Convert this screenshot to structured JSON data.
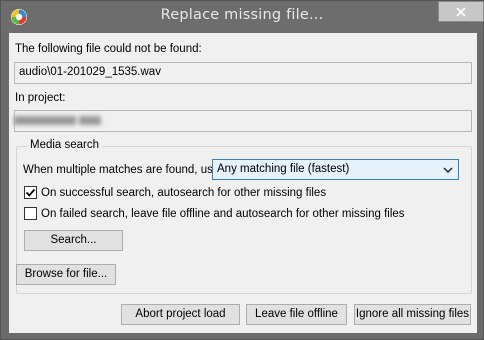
{
  "window": {
    "title": "Replace missing file..."
  },
  "dialog": {
    "missing_label": "The following file could not be found:",
    "missing_file": "audio\\01-201029_1535.wav",
    "project_label": "In project:",
    "project_value": ""
  },
  "media_search": {
    "group_title": "Media search",
    "multiple_label": "When multiple matches are found, use:",
    "match_mode": "Any matching file (fastest)",
    "autosearch_success": {
      "label": "On successful search, autosearch for other missing files",
      "checked": true
    },
    "autosearch_failed": {
      "label": "On failed search, leave file offline and autosearch for other missing files",
      "checked": false
    },
    "search_button": "Search..."
  },
  "buttons": {
    "browse": "Browse for file...",
    "abort": "Abort project load",
    "leave_offline": "Leave file offline",
    "ignore_all": "Ignore all missing files"
  },
  "colors": {
    "titlebar": "#6d6d6d",
    "client": "#f0f0f0",
    "combo_accent": "#3c7fb1"
  }
}
